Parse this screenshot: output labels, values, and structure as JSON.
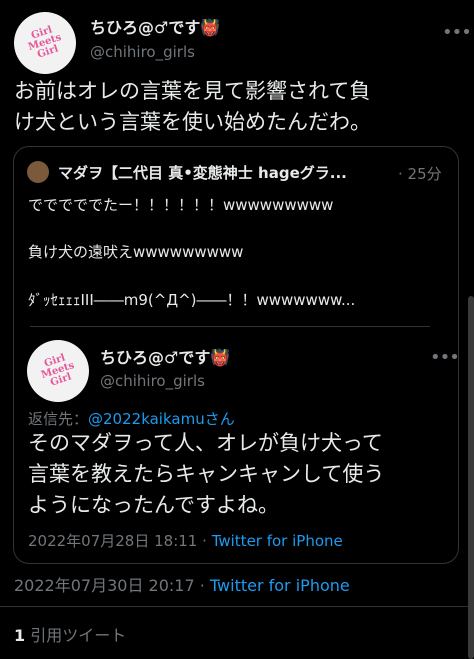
{
  "tweet": {
    "display_name": "ちひろ@♂です",
    "emoji": "👹",
    "handle": "@chihiro_girls",
    "avatar_text": "Girl Meets Girl",
    "text_line1": "お前はオレの言葉を見て影響されて負",
    "text_line2": "け犬という言葉を使い始めたんだわ。",
    "timestamp": "2022年07月30日 20:17",
    "source": "Twitter for iPhone",
    "quote_count": "1",
    "quote_label": "引用ツイート"
  },
  "quoted": {
    "display_name": "マダヲ【二代目 真•変態神士 hageグラ...",
    "time_ago": "25分",
    "line1": "でででででたー！！！！！！wwwwwwwww",
    "line2": "負け犬の遠吠えwwwwwwwww",
    "line3": "ﾀﾞｯｾｪｪｪIII――m9(^Д^)――！！wwwwwww..."
  },
  "reply": {
    "display_name": "ちひろ@♂です",
    "emoji": "👹",
    "handle": "@chihiro_girls",
    "avatar_text": "Girl Meets Girl",
    "replying_to_label": "返信先：",
    "replying_to_user": "@2022kaikamuさん",
    "text_line1": "そのマダヲって人、オレが負け犬って",
    "text_line2": "言葉を教えたらキャンキャンして使う",
    "text_line3": "ようになったんですよね。",
    "timestamp": "2022年07月28日 18:11",
    "separator": "·",
    "source": "Twitter for iPhone"
  },
  "colors": {
    "background": "#000000",
    "text": "#e7e9ea",
    "secondary": "#71767b",
    "link": "#1d9bf0",
    "border": "#2f3336"
  }
}
